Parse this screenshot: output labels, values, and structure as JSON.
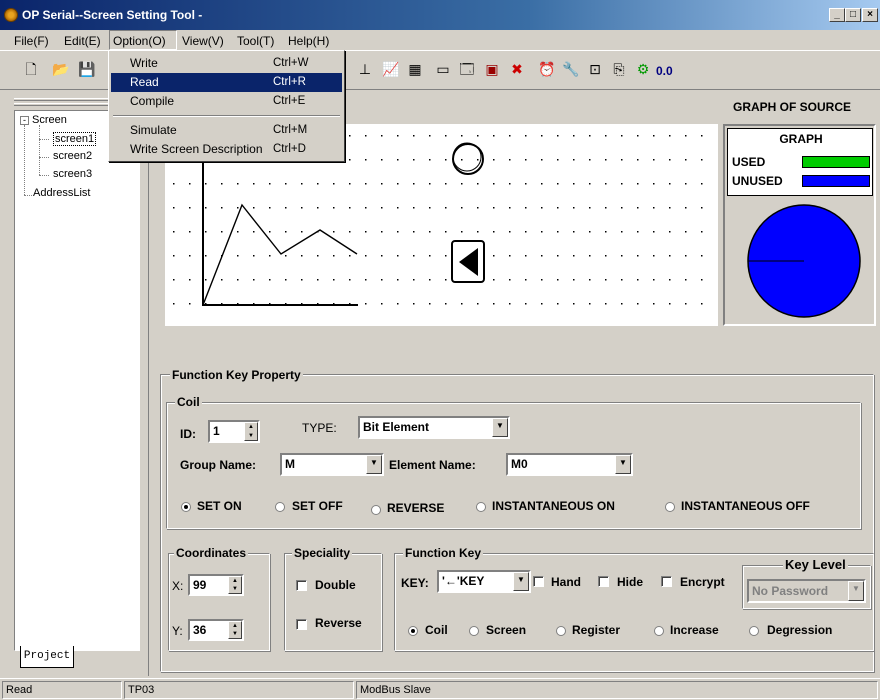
{
  "window": {
    "title": "OP Serial--Screen Setting Tool -"
  },
  "menubar": [
    "File(F)",
    "Edit(E)",
    "Option(O)",
    "View(V)",
    "Tool(T)",
    "Help(H)"
  ],
  "option_menu": [
    {
      "label": "Write",
      "shortcut": "Ctrl+W"
    },
    {
      "label": "Read",
      "shortcut": "Ctrl+R",
      "selected": true
    },
    {
      "label": "Compile",
      "shortcut": "Ctrl+E"
    },
    {
      "label": "Simulate",
      "shortcut": "Ctrl+M"
    },
    {
      "label": "Write Screen Description",
      "shortcut": "Ctrl+D"
    }
  ],
  "toolbar": {
    "zoom_value": "0.0"
  },
  "tree": {
    "root": "Screen",
    "children": [
      "screen1",
      "screen2",
      "screen3"
    ],
    "address_list": "AddressList"
  },
  "project_tab": "Project",
  "graph": {
    "title": "GRAPH OF SOURCE",
    "legend_title": "GRAPH",
    "used_label": "USED",
    "unused_label": "UNUSED",
    "used_color": "#00cc00",
    "unused_color": "#0000ff"
  },
  "function_key": {
    "frame_title": "Function Key Property",
    "coil_title": "Coil",
    "id_label": "ID:",
    "id_value": "1",
    "type_label": "TYPE:",
    "type_value": "Bit Element",
    "group_label": "Group Name:",
    "group_value": "M",
    "element_label": "Element Name:",
    "element_value": "M0",
    "modes": [
      "SET ON",
      "SET OFF",
      "REVERSE",
      "INSTANTANEOUS ON",
      "INSTANTANEOUS OFF"
    ],
    "selected_mode": "SET ON",
    "coord_title": "Coordinates",
    "x_label": "X:",
    "x_value": "99",
    "y_label": "Y:",
    "y_value": "36",
    "speciality_title": "Speciality",
    "double_label": "Double",
    "reverse_label": "Reverse",
    "fkey_title": "Function Key",
    "key_label": "KEY:",
    "key_value": "'←'KEY",
    "hand_label": "Hand",
    "hide_label": "Hide",
    "encrypt_label": "Encrypt",
    "key_level_title": "Key Level",
    "key_level_value": "No Password",
    "targets": [
      "Coil",
      "Screen",
      "Register",
      "Increase",
      "Degression"
    ],
    "selected_target": "Coil"
  },
  "statusbar": {
    "left": "Read",
    "middle": "TP03",
    "right": "ModBus Slave"
  }
}
